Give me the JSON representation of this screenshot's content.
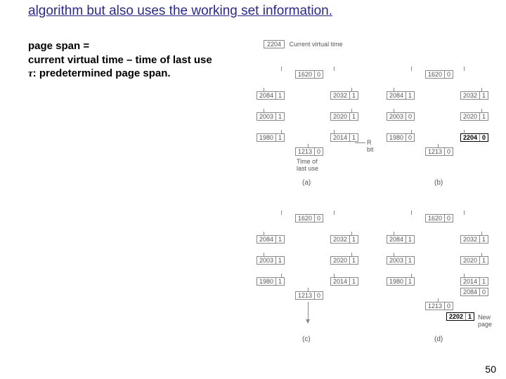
{
  "title": "algorithm but also uses the working set information.",
  "desc": {
    "line1": "page span =",
    "line2": "current virtual time – time of last use",
    "line3_tau": "τ",
    "line3_rest": ": predetermined page span."
  },
  "header": {
    "cvt_value": "2204",
    "cvt_label": "Current virtual time"
  },
  "labels": {
    "time_of_last_use_1": "Time of",
    "time_of_last_use_2": "last use",
    "r_bit": "R bit",
    "new_page": "New page"
  },
  "subfigs": {
    "a": "(a)",
    "b": "(b)",
    "c": "(c)",
    "d": "(d)"
  },
  "panels": {
    "a": {
      "top": {
        "t": "1620",
        "r": "0"
      },
      "row1": [
        {
          "t": "2084",
          "r": "1"
        },
        {
          "t": "2032",
          "r": "1"
        }
      ],
      "row2": [
        {
          "t": "2003",
          "r": "1"
        },
        {
          "t": "2020",
          "r": "1"
        }
      ],
      "row3": [
        {
          "t": "1980",
          "r": "1"
        },
        {
          "t": "2014",
          "r": "1"
        }
      ],
      "bottom": {
        "t": "1213",
        "r": "0"
      }
    },
    "b": {
      "top": {
        "t": "1620",
        "r": "0"
      },
      "row1": [
        {
          "t": "2084",
          "r": "1"
        },
        {
          "t": "2032",
          "r": "1"
        }
      ],
      "row2": [
        {
          "t": "2003",
          "r": "0"
        },
        {
          "t": "2020",
          "r": "1"
        }
      ],
      "row3": [
        {
          "t": "1980",
          "r": "0"
        },
        {
          "t": "2204",
          "r": "0"
        }
      ],
      "bottom": {
        "t": "1213",
        "r": "0"
      }
    },
    "c": {
      "top": {
        "t": "1620",
        "r": "0"
      },
      "row1": [
        {
          "t": "2084",
          "r": "1"
        },
        {
          "t": "2032",
          "r": "1"
        }
      ],
      "row2": [
        {
          "t": "2003",
          "r": "1"
        },
        {
          "t": "2020",
          "r": "1"
        }
      ],
      "row3": [
        {
          "t": "1980",
          "r": "1"
        },
        {
          "t": "2014",
          "r": "1"
        }
      ],
      "bottom": {
        "t": "1213",
        "r": "0"
      }
    },
    "d": {
      "top": {
        "t": "1620",
        "r": "0"
      },
      "row1": [
        {
          "t": "2084",
          "r": "1"
        },
        {
          "t": "2032",
          "r": "1"
        }
      ],
      "row2": [
        {
          "t": "2003",
          "r": "1"
        },
        {
          "t": "2020",
          "r": "1"
        }
      ],
      "row3": [
        {
          "t": "1980",
          "r": "1"
        },
        {
          "t": "2014",
          "r": "1"
        }
      ],
      "row3b": {
        "t": "2084",
        "r": "0"
      },
      "bottom": {
        "t": "1213",
        "r": "0"
      },
      "new": {
        "t": "2202",
        "r": "1"
      }
    }
  },
  "slidenum": "50"
}
